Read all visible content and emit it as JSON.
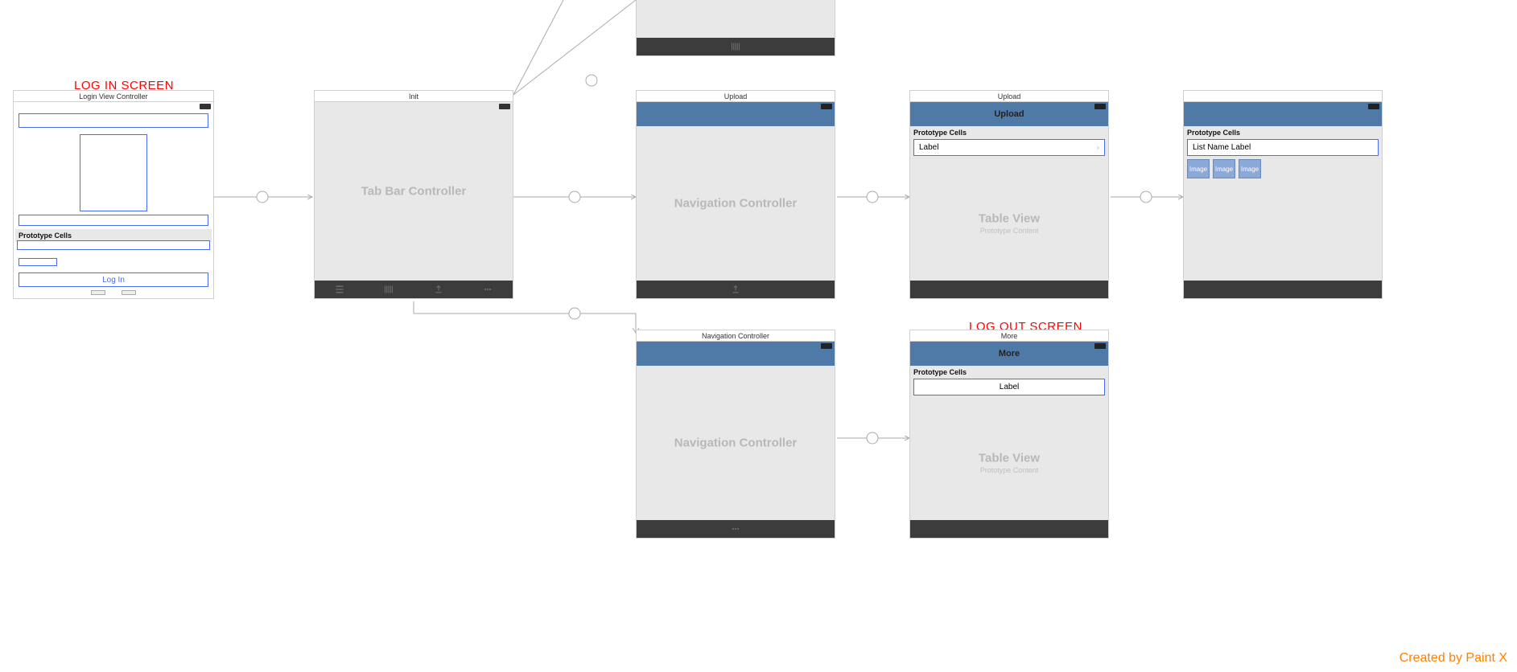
{
  "annotations": {
    "login": "LOG IN SCREEN",
    "logout": "LOG OUT SCREEN"
  },
  "scenes": {
    "login": {
      "title": "Login View Controller",
      "prototype_header": "Prototype Cells",
      "login_button": "Log In"
    },
    "tabbar": {
      "title": "Init",
      "label": "Tab Bar Controller",
      "tabs": [
        "My List",
        "Scanner",
        "Upload",
        "More"
      ]
    },
    "scanner_partial": {
      "tab_label": "Scanner"
    },
    "nav_upload": {
      "title": "Upload",
      "label": "Navigation Controller"
    },
    "nav_more": {
      "title": "Navigation Controller",
      "label": "Navigation Controller",
      "tab_label": "More"
    },
    "upload_table": {
      "title": "Upload",
      "nav_title": "Upload",
      "prototype_header": "Prototype Cells",
      "cell_label": "Label",
      "body_label": "Table View",
      "body_sub": "Prototype Content"
    },
    "more_table": {
      "title": "More",
      "nav_title": "More",
      "prototype_header": "Prototype Cells",
      "cell_label": "Label",
      "body_label": "Table View",
      "body_sub": "Prototype Content"
    },
    "detail_partial": {
      "prototype_header": "Prototype Cells",
      "cell_label": "List Name Label",
      "chip": "Image"
    }
  },
  "watermark": "Created by Paint X"
}
